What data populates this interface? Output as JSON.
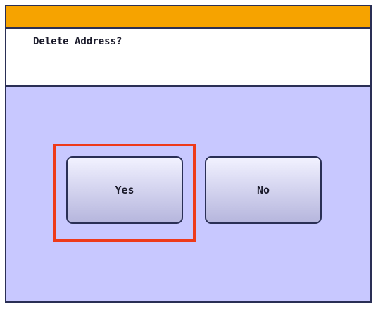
{
  "dialog": {
    "message": "Delete Address?"
  },
  "buttons": {
    "yes_label": "Yes",
    "no_label": "No"
  },
  "colors": {
    "header_strip": "#f6a300",
    "panel_background": "#c8c8ff",
    "message_background": "#ffffff",
    "border": "#2a2f55",
    "highlight": "#ee3a1a"
  }
}
